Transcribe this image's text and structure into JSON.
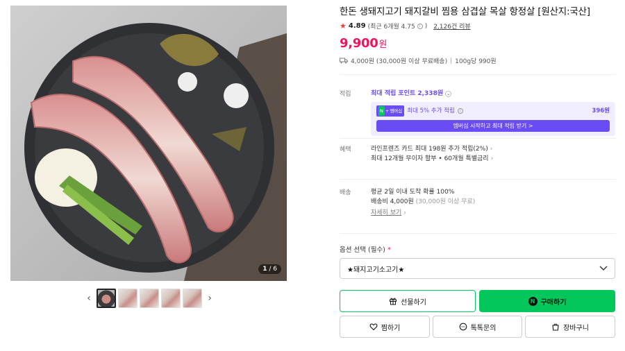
{
  "gallery": {
    "counter_current": "1",
    "counter_total": "/ 6",
    "thumbnails": [
      "thumb-1",
      "thumb-2",
      "thumb-3",
      "thumb-4",
      "thumb-5"
    ],
    "prev_icon": "chevron-left-icon",
    "next_icon": "chevron-right-icon"
  },
  "product": {
    "title": "한돈 생돼지고기 돼지갈비 찜용 삼겹살 목살 항정살 [원산지:국산]",
    "rating": "4.89",
    "rating_recent": "(최근 6개월 4.75",
    "reviews": "2,126건 리뷰",
    "price": "9,900",
    "currency": "원",
    "shipping": "4,000원 (30,000원 이상 무료배송)",
    "unit_price": "100g당 990원"
  },
  "points": {
    "label": "적립",
    "max_text": "최대 적립 포인트 2,338원",
    "membership_badge": "멤버십",
    "membership_text": "최대 5% 추가 적립",
    "membership_points": "396원",
    "membership_button": "멤버십 시작하고 최대 적립 받기 >"
  },
  "benefits": {
    "label": "혜택",
    "line1": "라인프렌즈 카드 최대 198원 추가 적립(2%)",
    "line2": "최대 12개월 무이자 할부 • 60개월 특별금리"
  },
  "delivery": {
    "label": "배송",
    "line1": "평균 2일 이내 도착 확률 100%",
    "fee": "배송비 4,000원",
    "fee_note": "(30,000원 이상 무료)",
    "more": "자세히 보기"
  },
  "option": {
    "label": "옵션 선택 (필수)",
    "required_mark": "*",
    "selected": "★돼지고기소고기★"
  },
  "actions": {
    "gift": "선물하기",
    "buy": "구매하기",
    "buy_badge": "N",
    "wishlist": "찜하기",
    "talk": "톡톡문의",
    "cart": "장바구니"
  },
  "colors": {
    "price": "#f0125a",
    "naver_green": "#03c75a",
    "membership_purple": "#6a4cf5"
  }
}
